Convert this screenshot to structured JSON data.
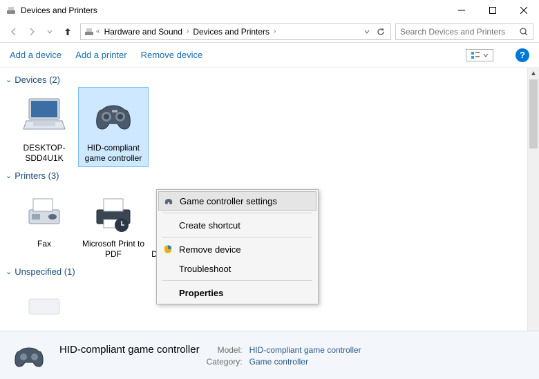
{
  "window": {
    "title": "Devices and Printers"
  },
  "breadcrumb": {
    "seg1": "Hardware and Sound",
    "seg2": "Devices and Printers"
  },
  "search": {
    "placeholder": "Search Devices and Printers"
  },
  "commands": {
    "addDevice": "Add a device",
    "addPrinter": "Add a printer",
    "removeDevice": "Remove device"
  },
  "groups": {
    "devices": {
      "title": "Devices (2)",
      "items": [
        "DESKTOP-SDD4U1K",
        "HID-compliant game controller"
      ]
    },
    "printers": {
      "title": "Printers (3)",
      "items": [
        "Fax",
        "Microsoft Print to PDF",
        "Microsoft XPS Document Writer"
      ]
    },
    "unspecified": {
      "title": "Unspecified (1)"
    }
  },
  "contextMenu": {
    "gameControllerSettings": "Game controller settings",
    "createShortcut": "Create shortcut",
    "removeDevice": "Remove device",
    "troubleshoot": "Troubleshoot",
    "properties": "Properties"
  },
  "details": {
    "name": "HID-compliant game controller",
    "modelLabel": "Model:",
    "modelValue": "HID-compliant game controller",
    "categoryLabel": "Category:",
    "categoryValue": "Game controller"
  }
}
